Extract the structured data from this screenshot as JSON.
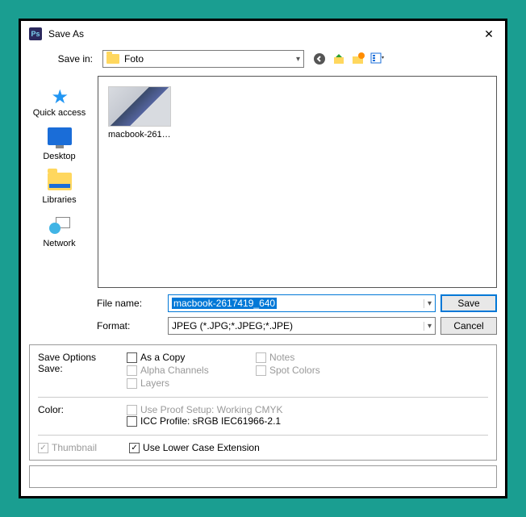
{
  "window": {
    "title": "Save As",
    "app_icon_text": "Ps"
  },
  "topbar": {
    "save_in_label": "Save in:",
    "folder_name": "Foto"
  },
  "sidebar": {
    "items": [
      {
        "label": "Quick access"
      },
      {
        "label": "Desktop"
      },
      {
        "label": "Libraries"
      },
      {
        "label": "Network"
      }
    ]
  },
  "files": [
    {
      "caption": "macbook-26174..."
    }
  ],
  "form": {
    "filename_label": "File name:",
    "filename_value": "macbook-2617419_640",
    "format_label": "Format:",
    "format_value": "JPEG (*.JPG;*.JPEG;*.JPE)",
    "save_btn": "Save",
    "cancel_btn": "Cancel"
  },
  "options": {
    "header": "Save Options",
    "save_label": "Save:",
    "as_a_copy": "As a Copy",
    "notes": "Notes",
    "alpha": "Alpha Channels",
    "spot": "Spot Colors",
    "layers": "Layers",
    "color_label": "Color:",
    "proof_setup": "Use Proof Setup:  Working CMYK",
    "icc_profile": "ICC Profile:  sRGB IEC61966-2.1",
    "thumbnail": "Thumbnail",
    "lowercase": "Use Lower Case Extension"
  }
}
